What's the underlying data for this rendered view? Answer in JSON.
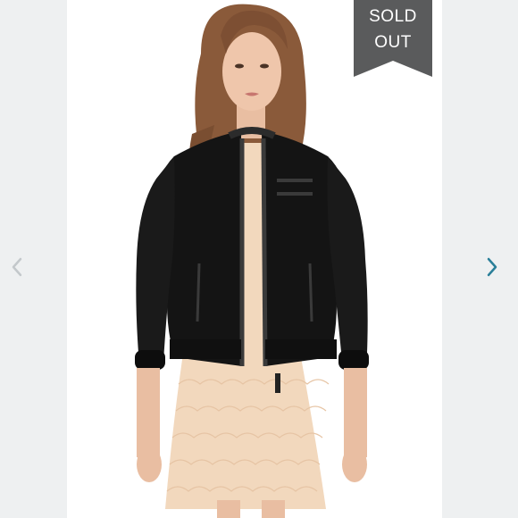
{
  "listing": {
    "badge": {
      "line1": "SOLD",
      "line2": "OUT",
      "color": "#5a5b5c"
    },
    "nav": {
      "prev_icon": "chevron-left-icon",
      "next_icon": "chevron-right-icon",
      "prev_color": "#c3c8cb",
      "next_color": "#2a7f99"
    },
    "photo_icon": "product-photo"
  }
}
